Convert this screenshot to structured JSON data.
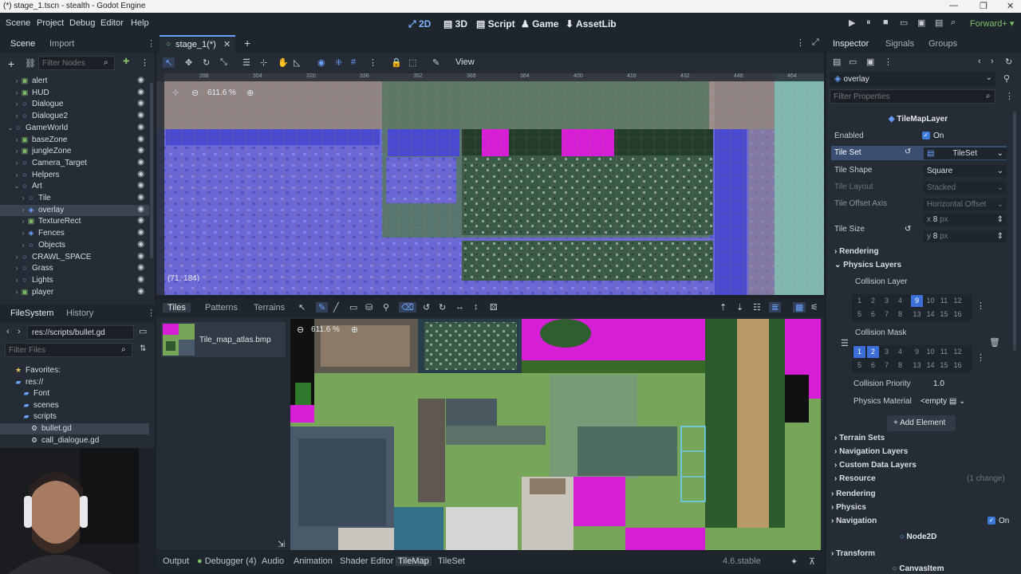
{
  "window": {
    "title": "(*) stage_1.tscn - stealth - Godot Engine",
    "controls": [
      "—",
      "❐",
      "✕"
    ]
  },
  "menus": [
    "Scene",
    "Project",
    "Debug",
    "Editor",
    "Help"
  ],
  "workspaces": [
    {
      "label": "2D",
      "active": true
    },
    {
      "label": "3D",
      "active": false
    },
    {
      "label": "Script",
      "active": false
    },
    {
      "label": "Game",
      "active": false
    },
    {
      "label": "AssetLib",
      "active": false
    }
  ],
  "renderer": "Forward+",
  "scene_dock": {
    "tabs": [
      "Scene",
      "Import"
    ],
    "filter_placeholder": "Filter Nodes",
    "nodes": [
      {
        "label": "alert",
        "icon": "label-icon",
        "indent": 2
      },
      {
        "label": "HUD",
        "icon": "label-icon",
        "indent": 2
      },
      {
        "label": "Dialogue",
        "icon": "node-icon",
        "indent": 2
      },
      {
        "label": "Dialogue2",
        "icon": "node-icon",
        "indent": 2
      },
      {
        "label": "GameWorld",
        "icon": "node2d-icon",
        "indent": 1
      },
      {
        "label": "baseZone",
        "icon": "area-icon",
        "indent": 2
      },
      {
        "label": "jungleZone",
        "icon": "area-icon",
        "indent": 2
      },
      {
        "label": "Camera_Target",
        "icon": "node2d-icon",
        "indent": 2
      },
      {
        "label": "Helpers",
        "icon": "node2d-icon",
        "indent": 2
      },
      {
        "label": "Art",
        "icon": "node2d-icon",
        "indent": 2
      },
      {
        "label": "Tile",
        "icon": "node2d-icon",
        "indent": 3
      },
      {
        "label": "overlay",
        "icon": "tilemaplayer-icon",
        "indent": 3,
        "selected": true
      },
      {
        "label": "TextureRect",
        "icon": "texture-icon",
        "indent": 3
      },
      {
        "label": "Fences",
        "icon": "tilemaplayer-icon",
        "indent": 3
      },
      {
        "label": "Objects",
        "icon": "node2d-icon",
        "indent": 3
      },
      {
        "label": "CRAWL_SPACE",
        "icon": "node2d-icon",
        "indent": 2
      },
      {
        "label": "Grass",
        "icon": "node2d-icon",
        "indent": 2
      },
      {
        "label": "Lights",
        "icon": "node2d-icon",
        "indent": 2
      },
      {
        "label": "player",
        "icon": "area-icon",
        "indent": 2
      }
    ]
  },
  "filesystem_dock": {
    "tabs": [
      "FileSystem",
      "History"
    ],
    "path": "res://scripts/bullet.gd",
    "filter_placeholder": "Filter Files",
    "items": [
      {
        "label": "Favorites:",
        "icon": "star-icon",
        "indent": 1
      },
      {
        "label": "res://",
        "icon": "folder-icon",
        "indent": 1
      },
      {
        "label": "Font",
        "icon": "folder-icon",
        "indent": 2
      },
      {
        "label": "scenes",
        "icon": "folder-icon",
        "indent": 2
      },
      {
        "label": "scripts",
        "icon": "folder-icon",
        "indent": 2
      },
      {
        "label": "bullet.gd",
        "icon": "gear-icon",
        "indent": 3,
        "selected": true
      },
      {
        "label": "call_dialogue.gd",
        "icon": "gear-icon",
        "indent": 3
      }
    ]
  },
  "editor_tabs": [
    {
      "label": "stage_1(*)"
    }
  ],
  "viewport": {
    "view_menu": "View",
    "zoom": "611.6 %",
    "coords": "(71, 184)",
    "ruler_marks": [
      "288",
      "304",
      "320",
      "336",
      "352",
      "368",
      "384",
      "400",
      "416",
      "432",
      "448",
      "464"
    ]
  },
  "tilemap_panel": {
    "tabs": [
      "Tiles",
      "Patterns",
      "Terrains"
    ],
    "atlas_name": "Tile_map_atlas.bmp",
    "zoom": "611.6 %"
  },
  "bottom_bar": {
    "items": [
      "Output",
      "Debugger (4)",
      "Audio",
      "Animation",
      "Shader Editor",
      "TileMap",
      "TileSet"
    ],
    "active": "TileMap",
    "version": "4.6.stable"
  },
  "inspector": {
    "tabs": [
      "Inspector",
      "Signals",
      "Groups"
    ],
    "object": "overlay",
    "filter_placeholder": "Filter Properties",
    "class_header": "TileMapLayer",
    "enabled_label": "Enabled",
    "enabled_value": "On",
    "tile_set_label": "Tile Set",
    "tile_set_value": "TileSet",
    "tile_shape_label": "Tile Shape",
    "tile_shape_value": "Square",
    "tile_layout_label": "Tile Layout",
    "tile_layout_value": "Stacked",
    "tile_offset_label": "Tile Offset Axis",
    "tile_offset_value": "Horizontal Offset",
    "tile_size_label": "Tile Size",
    "tile_size_x": "8",
    "tile_size_y": "8",
    "px_unit": "px",
    "x_label": "x",
    "y_label": "y",
    "sections": {
      "rendering": "Rendering",
      "physics_layers": "Physics Layers",
      "collision_layer": "Collision Layer",
      "collision_mask": "Collision Mask",
      "collision_priority": "Collision Priority",
      "collision_priority_value": "1.0",
      "physics_material": "Physics Material",
      "physics_material_value": "<empty",
      "add_element": "Add Element",
      "terrain_sets": "Terrain Sets",
      "navigation_layers": "Navigation Layers",
      "custom_data_layers": "Custom Data Layers",
      "resource": "Resource",
      "resource_changes": "(1 change)",
      "rendering2": "Rendering",
      "physics": "Physics",
      "navigation": "Navigation",
      "navigation_value": "On",
      "node2d": "Node2D",
      "transform": "Transform",
      "canvas_item": "CanvasItem"
    },
    "collision_layer_bits": [
      "1",
      "2",
      "3",
      "4",
      "9",
      "10",
      "11",
      "12",
      "5",
      "6",
      "7",
      "8",
      "13",
      "14",
      "15",
      "16"
    ],
    "collision_layer_on": [
      "9"
    ],
    "collision_mask_on": [
      "1",
      "2"
    ]
  },
  "colors": {
    "accent": "#3d7bd8",
    "panel": "#262c35",
    "water": "#6a68d6",
    "magenta": "#e61ee6",
    "grass": "#77a55a"
  }
}
